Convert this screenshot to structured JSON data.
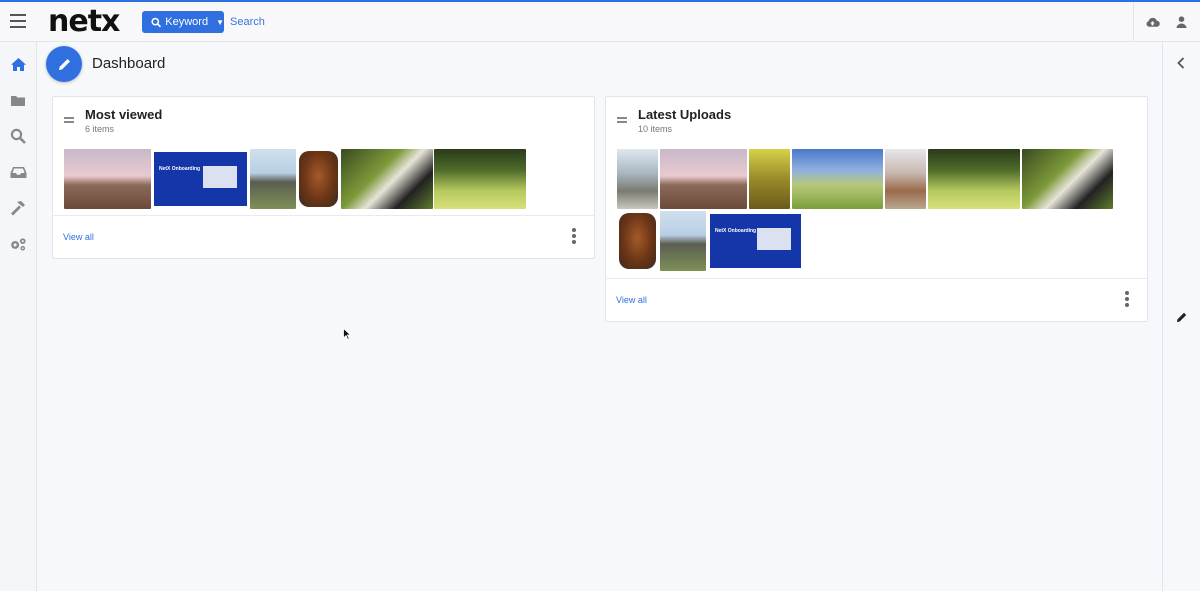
{
  "app": {
    "logo": "netx",
    "accent_color": "#2f6fe0"
  },
  "topbar": {
    "menu_icon": "hamburger-menu-icon",
    "search_mode_label": "Keyword",
    "search_placeholder": "Search",
    "upload_icon": "cloud-upload-icon",
    "user_icon": "user-icon"
  },
  "sidebar": {
    "items": [
      {
        "icon": "home-icon",
        "active": true
      },
      {
        "icon": "folder-icon",
        "active": false
      },
      {
        "icon": "search-icon",
        "active": false
      },
      {
        "icon": "inbox-icon",
        "active": false
      },
      {
        "icon": "hammer-icon",
        "active": false
      },
      {
        "icon": "gears-icon",
        "active": false
      }
    ]
  },
  "page": {
    "title": "Dashboard",
    "edit_icon": "pencil-icon"
  },
  "cards": {
    "most_viewed": {
      "title": "Most viewed",
      "count_label": "6 items",
      "view_all": "View all",
      "thumbnails": [
        "horse",
        "netx-onboarding",
        "cows",
        "roast",
        "cow-closeup",
        "cow-field"
      ]
    },
    "latest_uploads": {
      "title": "Latest Uploads",
      "count_label": "10 items",
      "view_all": "View all",
      "thumbnails": [
        "mountains",
        "horse",
        "highland-cow",
        "cows-blue-sky",
        "longhorn",
        "cow-field",
        "cow-closeup",
        "roast",
        "cows",
        "netx-onboarding"
      ]
    }
  },
  "onboarding_thumb_text": "NetX Onboarding",
  "right_rail": {
    "collapse_icon": "chevron-left-icon",
    "edit_icon": "pencil-icon"
  }
}
